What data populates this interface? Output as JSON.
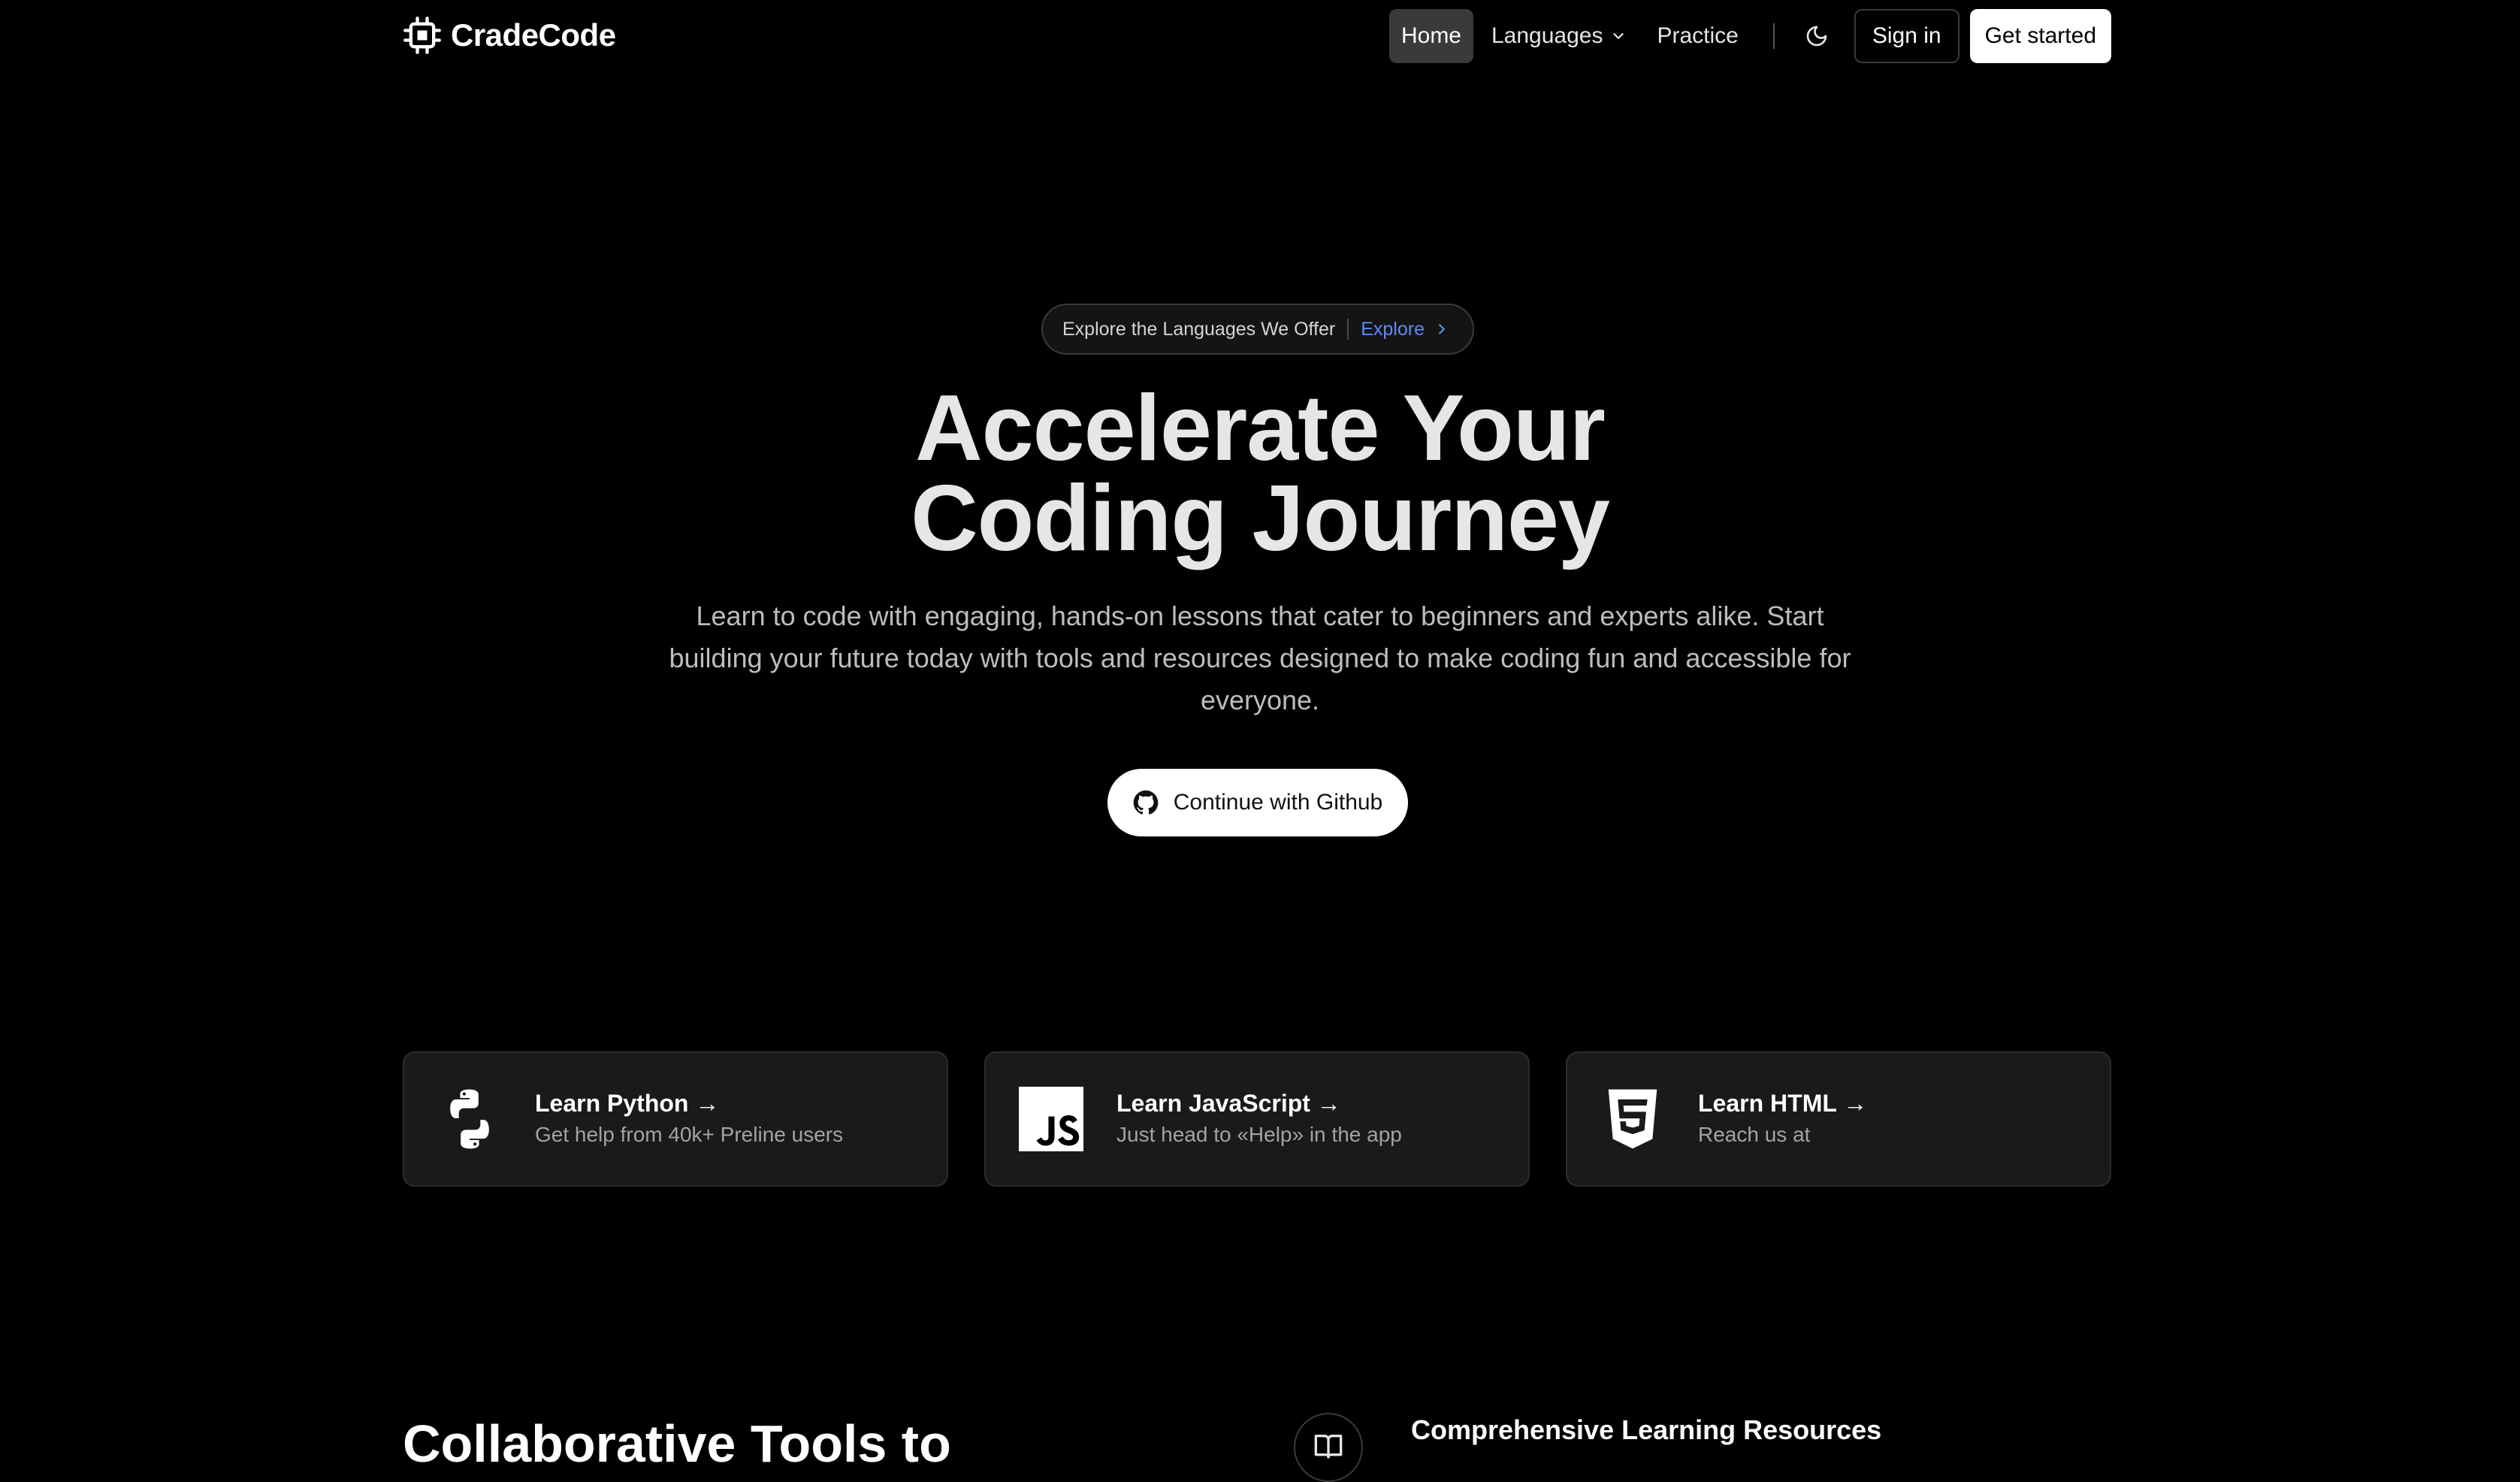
{
  "header": {
    "logo_text": "CradeCode",
    "nav": {
      "home": "Home",
      "languages": "Languages",
      "practice": "Practice"
    },
    "sign_in": "Sign in",
    "get_started": "Get started"
  },
  "hero": {
    "pill_text": "Explore the Languages We Offer",
    "pill_link": "Explore",
    "title_line1": "Accelerate Your",
    "title_line2": "Coding Journey",
    "subtitle": "Learn to code with engaging, hands-on lessons that cater to beginners and experts alike. Start building your future today with tools and resources designed to make coding fun and accessible for everyone.",
    "cta": "Continue with Github"
  },
  "cards": [
    {
      "title": "Learn Python →",
      "desc": "Get help from 40k+ Preline users",
      "icon": "python-icon"
    },
    {
      "title": "Learn JavaScript →",
      "desc": "Just head to «Help» in the app",
      "icon": "javascript-icon"
    },
    {
      "title": "Learn HTML →",
      "desc": "Reach us at",
      "icon": "html5-icon"
    }
  ],
  "section": {
    "title": "Collaborative Tools to",
    "feature_title": "Comprehensive Learning Resources"
  },
  "colors": {
    "background": "#000000",
    "accent_link": "#5b8cf5",
    "card_bg": "#1a1a1a"
  }
}
